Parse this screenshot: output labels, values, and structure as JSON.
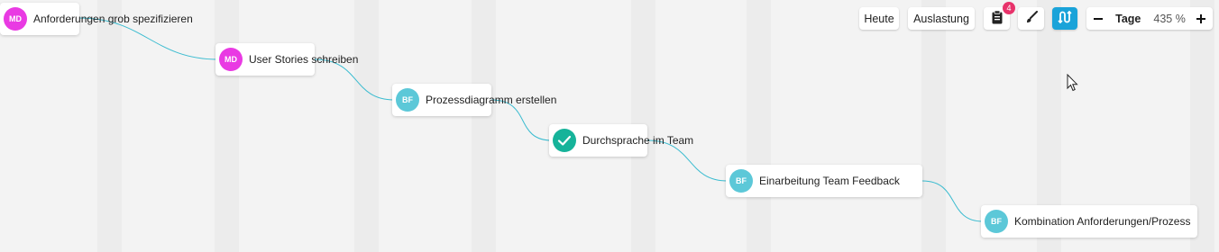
{
  "tasks": [
    {
      "label": "Anforderungen grob spezifizieren",
      "assignee": "MD",
      "status": "open"
    },
    {
      "label": "User Stories schreiben",
      "assignee": "MD",
      "status": "open"
    },
    {
      "label": "Prozessdiagramm erstellen",
      "assignee": "BF",
      "status": "open"
    },
    {
      "label": "Durchsprache im Team",
      "assignee": "",
      "status": "done"
    },
    {
      "label": "Einarbeitung Team Feedback",
      "assignee": "BF",
      "status": "open"
    },
    {
      "label": "Kombination Anforderungen/Prozess",
      "assignee": "BF",
      "status": "open"
    }
  ],
  "toolbar": {
    "today_label": "Heute",
    "workload_label": "Auslastung",
    "tasks_badge_count": "4",
    "zoom_unit": "Tage",
    "zoom_value": "435 %"
  },
  "colors": {
    "md_avatar": "#e93ae3",
    "bf_avatar": "#5cc8d8",
    "done": "#16b39a",
    "link_line": "#3bbcd0",
    "active_button": "#1aa3d9",
    "badge": "#e8336b"
  }
}
